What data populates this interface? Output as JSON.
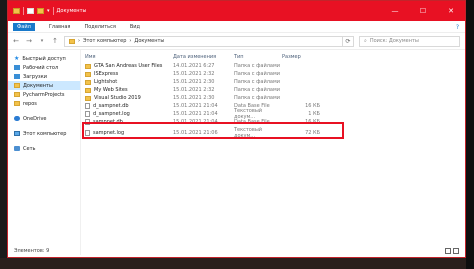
{
  "window": {
    "title": "Документы"
  },
  "menu": {
    "file": "Файл",
    "items": [
      "Главная",
      "Поделиться",
      "Вид"
    ],
    "help": "?"
  },
  "nav": {
    "back": "←",
    "forward": "→",
    "up": "↑",
    "breadcrumb": [
      "Этот компьютер",
      "Документы"
    ],
    "search_placeholder": "Поиск: Документы"
  },
  "sidebar": {
    "items": [
      {
        "label": "Быстрый доступ"
      },
      {
        "label": "Рабочий стол"
      },
      {
        "label": "Загрузки"
      },
      {
        "label": "Документы"
      },
      {
        "label": "PycharmProjects"
      },
      {
        "label": "repos"
      },
      {
        "label": "OneDrive"
      },
      {
        "label": "Этот компьютер"
      },
      {
        "label": "Сеть"
      }
    ]
  },
  "columns": {
    "name": "Имя",
    "date": "Дата изменения",
    "type": "Тип",
    "size": "Размер"
  },
  "files": [
    {
      "name": "GTA San Andreas User Files",
      "date": "14.01.2021 6:27",
      "type": "Папка с файлами",
      "size": ""
    },
    {
      "name": "ISExpress",
      "date": "15.01.2021 2:32",
      "type": "Папка с файлами",
      "size": ""
    },
    {
      "name": "Lightshot",
      "date": "15.01.2021 2:30",
      "type": "Папка с файлами",
      "size": ""
    },
    {
      "name": "My Web Sites",
      "date": "15.01.2021 2:32",
      "type": "Папка с файлами",
      "size": ""
    },
    {
      "name": "Visual Studio 2019",
      "date": "15.01.2021 2:30",
      "type": "Папка с файлами",
      "size": ""
    },
    {
      "name": "d_sampnet.db",
      "date": "15.01.2021 21:04",
      "type": "Data Base File",
      "size": "16 КБ"
    },
    {
      "name": "d_sampnet.log",
      "date": "15.01.2021 21:04",
      "type": "Текстовый докум...",
      "size": "1 КБ"
    },
    {
      "name": "sampnet.db",
      "date": "15.01.2021 21:04",
      "type": "Data Base File",
      "size": "16 КБ"
    },
    {
      "name": "sampnet.log",
      "date": "15.01.2021 21:06",
      "type": "Текстовый докум...",
      "size": "72 КБ"
    }
  ],
  "status": {
    "count": "Элементов: 9"
  }
}
